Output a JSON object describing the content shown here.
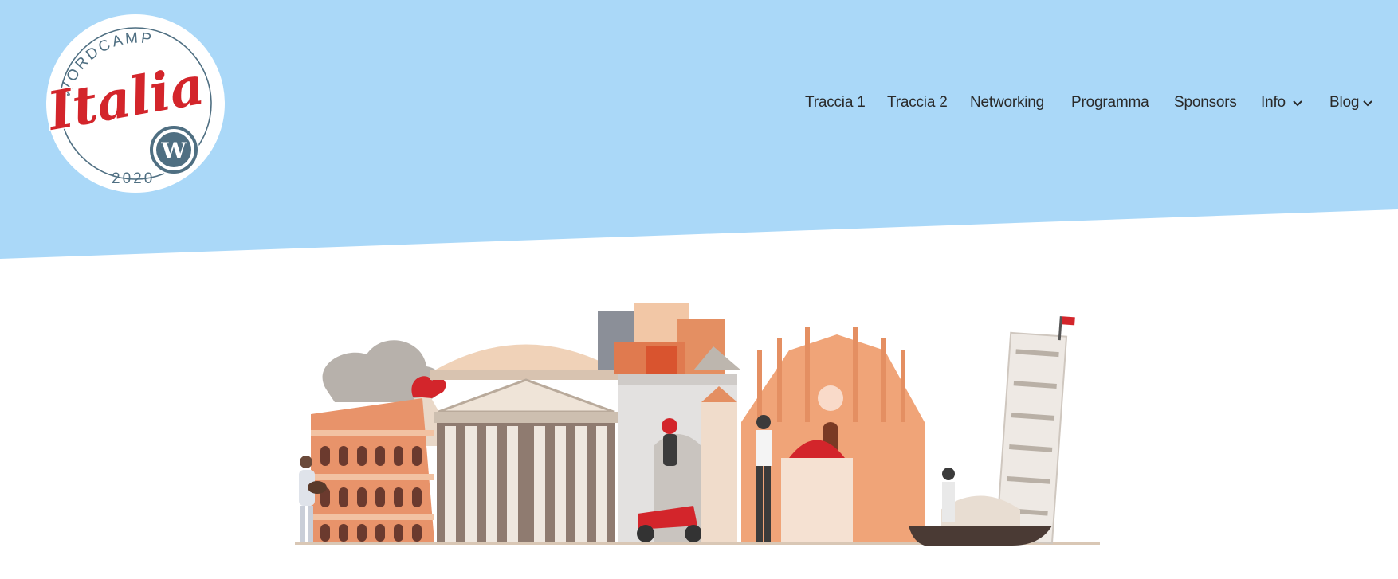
{
  "logo": {
    "arc_top": "WORDCAMP",
    "script": "Italia",
    "arc_bottom": "2020",
    "badge": "W"
  },
  "nav": {
    "items": [
      {
        "label": "Traccia 1",
        "has_dropdown": false
      },
      {
        "label": "Traccia 2",
        "has_dropdown": false
      },
      {
        "label": "Networking",
        "has_dropdown": false
      },
      {
        "label": "Programma",
        "has_dropdown": false
      },
      {
        "label": "Sponsors",
        "has_dropdown": false
      },
      {
        "label": "Info",
        "has_dropdown": true
      },
      {
        "label": "Blog",
        "has_dropdown": true
      }
    ]
  },
  "colors": {
    "header_bg": "#aad8f8",
    "brand_red": "#d3252b",
    "ink": "#4f6f82",
    "nav_text": "#2a2a2a"
  },
  "hero": {
    "illustration": "italian-landmarks-skyline"
  }
}
